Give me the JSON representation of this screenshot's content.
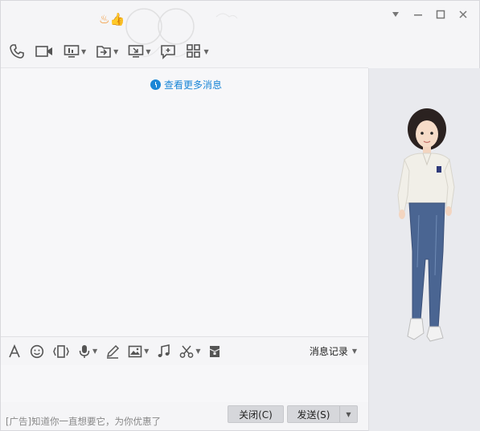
{
  "window": {
    "controls": {
      "menu_icon": "triangle-down-icon",
      "minimize_icon": "minimize-icon",
      "maximize_icon": "maximize-icon",
      "close_icon": "close-icon"
    }
  },
  "toolbar": {
    "items": [
      {
        "name": "voice-call",
        "icon": "phone-icon",
        "has_dropdown": false
      },
      {
        "name": "video-call",
        "icon": "video-camera-icon",
        "has_dropdown": false
      },
      {
        "name": "screen-share",
        "icon": "screen-share-icon",
        "has_dropdown": true
      },
      {
        "name": "send-file",
        "icon": "send-file-icon",
        "has_dropdown": true
      },
      {
        "name": "remote-desktop",
        "icon": "remote-desktop-icon",
        "has_dropdown": true
      },
      {
        "name": "create-discussion",
        "icon": "add-chat-icon",
        "has_dropdown": false
      },
      {
        "name": "apps",
        "icon": "apps-grid-icon",
        "has_dropdown": true
      }
    ]
  },
  "messages": {
    "more_label": "查看更多消息"
  },
  "input_toolbar": {
    "items": [
      {
        "name": "font",
        "icon": "font-icon",
        "has_dropdown": false
      },
      {
        "name": "emoji",
        "icon": "smiley-icon",
        "has_dropdown": false
      },
      {
        "name": "shake",
        "icon": "shake-icon",
        "has_dropdown": false
      },
      {
        "name": "voice",
        "icon": "microphone-icon",
        "has_dropdown": true
      },
      {
        "name": "doodle",
        "icon": "pencil-icon",
        "has_dropdown": false
      },
      {
        "name": "image",
        "icon": "image-icon",
        "has_dropdown": true
      },
      {
        "name": "music",
        "icon": "music-note-icon",
        "has_dropdown": false
      },
      {
        "name": "screenshot",
        "icon": "scissors-icon",
        "has_dropdown": true
      },
      {
        "name": "red-packet",
        "icon": "red-packet-icon",
        "has_dropdown": false
      }
    ],
    "history_label": "消息记录"
  },
  "bottom": {
    "ad_text": "[广告]知道你一直想要它，为你优惠了",
    "close_label": "关闭(C)",
    "send_label": "发送(S)"
  },
  "colors": {
    "link": "#1a86d6",
    "button_bg": "#d6d7db",
    "panel_bg": "#e9eaee"
  }
}
